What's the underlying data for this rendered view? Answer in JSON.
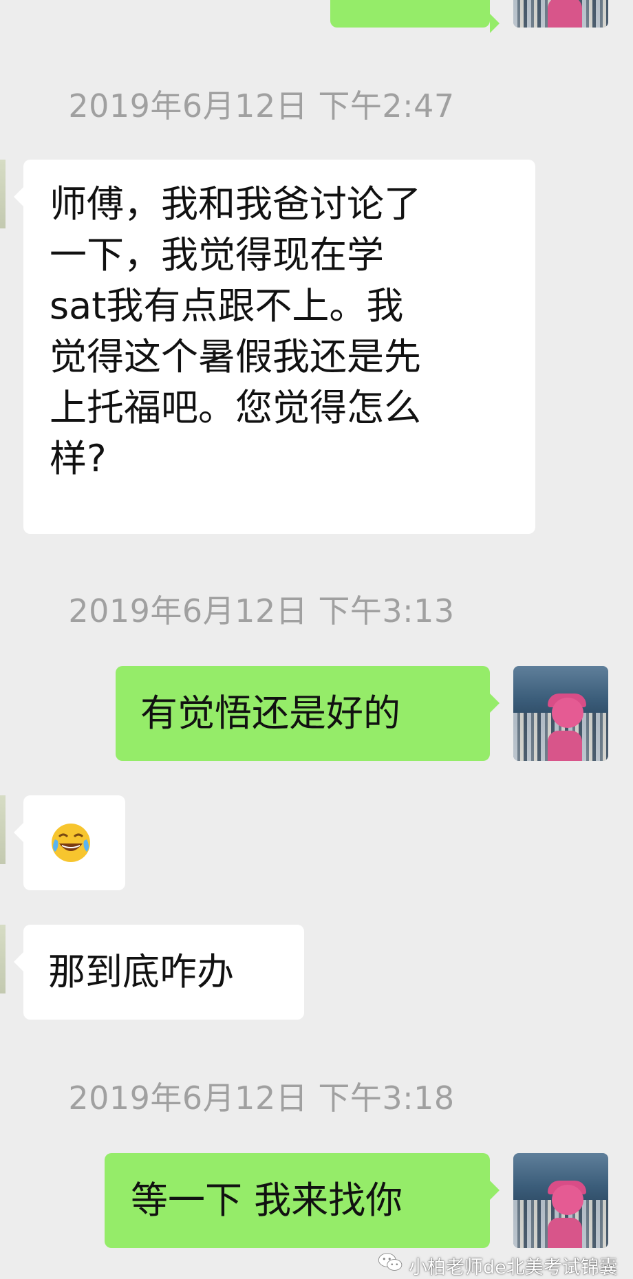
{
  "colors": {
    "background": "#ededed",
    "incoming_bubble": "#ffffff",
    "outgoing_bubble": "#95ec69",
    "timestamp_text": "#a0a0a0"
  },
  "messages": [
    {
      "type": "timestamp",
      "text": "2019年6月12日 下午2:47"
    },
    {
      "type": "incoming",
      "lines": [
        "师傅，我和我爸讨论了",
        "一下，我觉得现在学",
        "sat我有点跟不上。我",
        "觉得这个暑假我还是先",
        "上托福吧。您觉得怎么",
        "样?"
      ]
    },
    {
      "type": "timestamp",
      "text": "2019年6月12日 下午3:13"
    },
    {
      "type": "outgoing",
      "text": "有觉悟还是好的"
    },
    {
      "type": "incoming",
      "emoji": "tears-of-joy-emoji"
    },
    {
      "type": "incoming",
      "text": "那到底咋办"
    },
    {
      "type": "timestamp",
      "text": "2019年6月12日 下午3:18"
    },
    {
      "type": "outgoing",
      "text": "等一下 我来找你"
    }
  ],
  "watermark": {
    "icon": "wechat-icon",
    "text": "小柏老师de北美考试锦囊"
  }
}
